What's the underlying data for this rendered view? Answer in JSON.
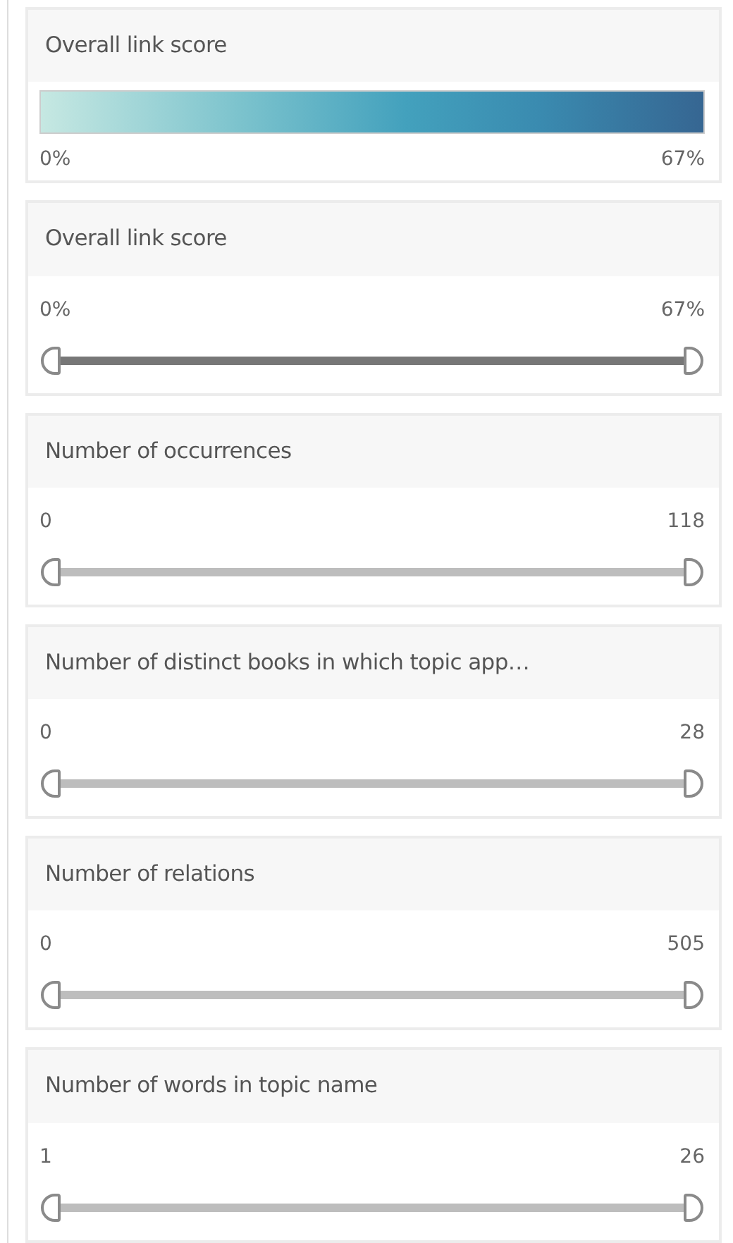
{
  "filters": [
    {
      "kind": "legend",
      "title": "Overall link score",
      "min_label": "0%",
      "max_label": "67%"
    },
    {
      "kind": "range",
      "title": "Overall link score",
      "min_label": "0%",
      "max_label": "67%",
      "active": true,
      "handles": [
        {
          "level": 0
        },
        {
          "level": 1
        }
      ]
    },
    {
      "kind": "range",
      "title": "Number of occurrences",
      "min_label": "0",
      "max_label": "118",
      "active": false,
      "handles": [
        {
          "level": 0
        },
        {
          "level": 1
        }
      ]
    },
    {
      "kind": "range",
      "title": "Number of distinct books in which topic app…",
      "min_label": "0",
      "max_label": "28",
      "active": false,
      "handles": [
        {
          "level": 0
        },
        {
          "level": 1
        }
      ]
    },
    {
      "kind": "range",
      "title": "Number of relations",
      "min_label": "0",
      "max_label": "505",
      "active": false,
      "handles": [
        {
          "level": 0
        },
        {
          "level": 1
        }
      ]
    },
    {
      "kind": "range",
      "title": "Number of words in topic name",
      "min_label": "1",
      "max_label": "26",
      "active": false,
      "handles": [
        {
          "level": 0
        },
        {
          "level": 1
        }
      ]
    }
  ]
}
